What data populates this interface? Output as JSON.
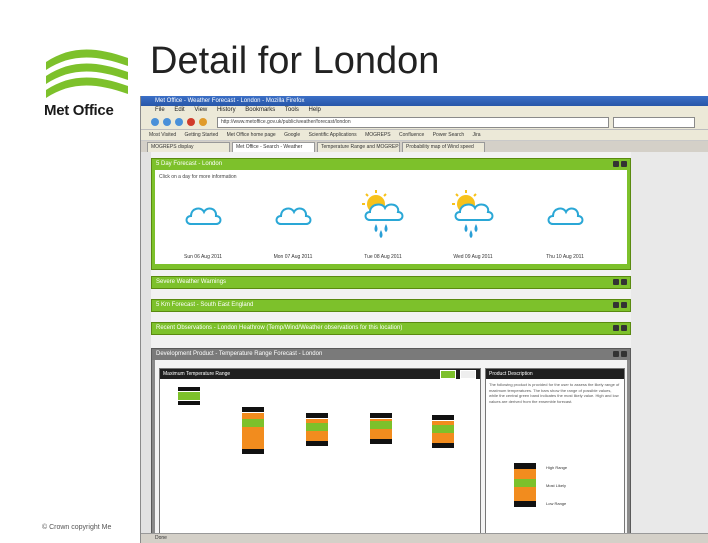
{
  "slide": {
    "title": "Detail for London",
    "logo_text": "Met Office",
    "copyright": "© Crown copyright   Me"
  },
  "browser": {
    "window_title": "Met Office - Weather Forecast - London - Mozilla Firefox",
    "menu": [
      "File",
      "Edit",
      "View",
      "History",
      "Bookmarks",
      "Tools",
      "Help"
    ],
    "address": "http://www.metoffice.gov.uk/public/weather/forecast/london",
    "bookmarks": [
      "Most Visited",
      "Getting Started",
      "Met Office home page",
      "Google",
      "Scientific Applications",
      "MOGREPS",
      "Confluence",
      "Power Search",
      "Jira"
    ],
    "tabs": [
      "MOGREPS display",
      "Met Office - Search - Weather",
      "Temperature Range and MOGREPS",
      "Probability map of Wind speed"
    ],
    "status": "Done"
  },
  "colors": {
    "panel_green": "#7dc12b",
    "header_dark": "#1f1f1f",
    "range_orange": "#f28c1e"
  },
  "page": {
    "forecast_panel": {
      "title": "5 Day Forecast - London",
      "hint": "Click on a day for more information",
      "days": [
        {
          "icon": "cloud-icon",
          "date": "Sun 06 Aug 2011"
        },
        {
          "icon": "cloud-icon",
          "date": "Mon 07 Aug 2011"
        },
        {
          "icon": "sun-rain-icon",
          "date": "Tue 08 Aug 2011"
        },
        {
          "icon": "sun-rain-icon",
          "date": "Wed 09 Aug 2011"
        },
        {
          "icon": "cloud-icon",
          "date": "Thu 10 Aug 2011"
        }
      ]
    },
    "collapsed_panels": [
      "Severe Weather Warnings",
      "5 Km Forecast - South East England",
      "Recent Observations - London Heathrow (Temp/Wind/Weather observations for this location)"
    ],
    "dev_panel": {
      "title": "Development Product - Temperature Range Forecast - London",
      "chart_title": "Maximum Temperature Range",
      "desc_title": "Product Description",
      "desc_text": "The following product is provided for the user to assess the likely range of maximum temperatures. The bars show the range of possible values, while the central green band indicates the most likely value. High and low values are derived from the ensemble forecast.",
      "legend": [
        "High Range",
        "Most Likely",
        "Low Range"
      ]
    }
  }
}
